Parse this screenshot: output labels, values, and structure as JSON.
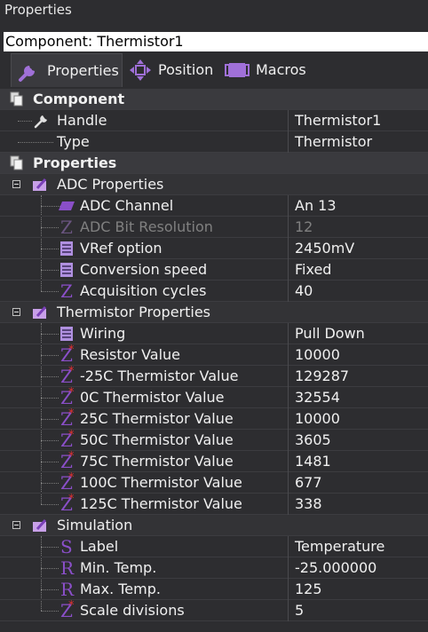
{
  "window": {
    "title": "Properties"
  },
  "component_label": "Component: Thermistor1",
  "tabs": [
    {
      "label": "Properties",
      "icon": "wrench-icon",
      "active": true
    },
    {
      "label": "Position",
      "icon": "move-arrows-icon",
      "active": false
    },
    {
      "label": "Macros",
      "icon": "macro-icon",
      "active": false
    }
  ],
  "sections": {
    "component": {
      "title": "Component",
      "rows": {
        "handle": {
          "label": "Handle",
          "value": "Thermistor1"
        },
        "type": {
          "label": "Type",
          "value": "Thermistor"
        }
      }
    },
    "properties": {
      "title": "Properties",
      "adc": {
        "title": "ADC Properties",
        "rows": {
          "channel": {
            "label": "ADC Channel",
            "value": "An 13"
          },
          "bit_res": {
            "label": "ADC Bit Resolution",
            "value": "12"
          },
          "vref": {
            "label": "VRef option",
            "value": "2450mV"
          },
          "conv_speed": {
            "label": "Conversion speed",
            "value": "Fixed"
          },
          "acq_cycles": {
            "label": "Acquisition cycles",
            "value": "40"
          }
        }
      },
      "thermistor": {
        "title": "Thermistor Properties",
        "rows": {
          "wiring": {
            "label": "Wiring",
            "value": "Pull Down"
          },
          "resistor": {
            "label": "Resistor Value",
            "value": "10000"
          },
          "t_m25": {
            "label": "-25C Thermistor Value",
            "value": "129287"
          },
          "t_0": {
            "label": "0C Thermistor Value",
            "value": "32554"
          },
          "t_25": {
            "label": "25C Thermistor Value",
            "value": "10000"
          },
          "t_50": {
            "label": "50C Thermistor Value",
            "value": "3605"
          },
          "t_75": {
            "label": "75C Thermistor Value",
            "value": "1481"
          },
          "t_100": {
            "label": "100C Thermistor Value",
            "value": "677"
          },
          "t_125": {
            "label": "125C Thermistor Value",
            "value": "338"
          }
        }
      },
      "simulation": {
        "title": "Simulation",
        "rows": {
          "label": {
            "label": "Label",
            "value": "Temperature"
          },
          "min_temp": {
            "label": "Min. Temp.",
            "value": "-25.000000"
          },
          "max_temp": {
            "label": "Max. Temp.",
            "value": "125"
          },
          "scale_div": {
            "label": "Scale divisions",
            "value": "5"
          }
        }
      }
    }
  },
  "colors": {
    "background": "#2d2d30",
    "header_row": "#3a3a3e",
    "glyph_purple": "#8a4fc8",
    "star_red": "#e03030",
    "disabled_text": "#808080"
  }
}
